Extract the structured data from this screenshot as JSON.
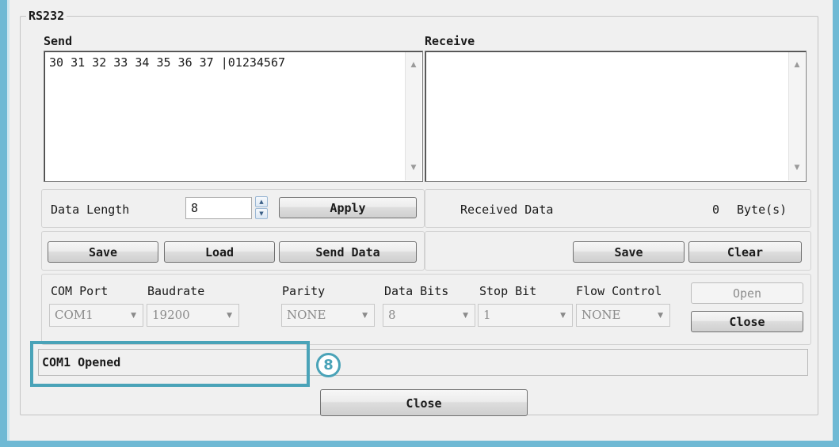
{
  "group": {
    "title": "RS232"
  },
  "send": {
    "label": "Send",
    "content": "30 31 32 33 34 35 36 37 |01234567",
    "data_length_label": "Data Length",
    "data_length_value": "8",
    "apply_label": "Apply",
    "save_label": "Save",
    "load_label": "Load",
    "send_data_label": "Send Data"
  },
  "receive": {
    "label": "Receive",
    "content": "",
    "received_data_label": "Received Data",
    "received_count": "0",
    "received_unit": "Byte(s)",
    "save_label": "Save",
    "clear_label": "Clear"
  },
  "settings": {
    "com_port_label": "COM Port",
    "com_port_value": "COM1",
    "baudrate_label": "Baudrate",
    "baudrate_value": "19200",
    "parity_label": "Parity",
    "parity_value": "NONE",
    "data_bits_label": "Data Bits",
    "data_bits_value": "8",
    "stop_bit_label": "Stop Bit",
    "stop_bit_value": "1",
    "flow_control_label": "Flow Control",
    "flow_control_value": "NONE",
    "open_label": "Open",
    "close_label": "Close"
  },
  "status": {
    "text": "COM1 Opened"
  },
  "annotation": {
    "badge": "8"
  },
  "footer": {
    "close_label": "Close"
  },
  "colors": {
    "frame": "#6fb9d4",
    "highlight": "#4aa3b8"
  }
}
